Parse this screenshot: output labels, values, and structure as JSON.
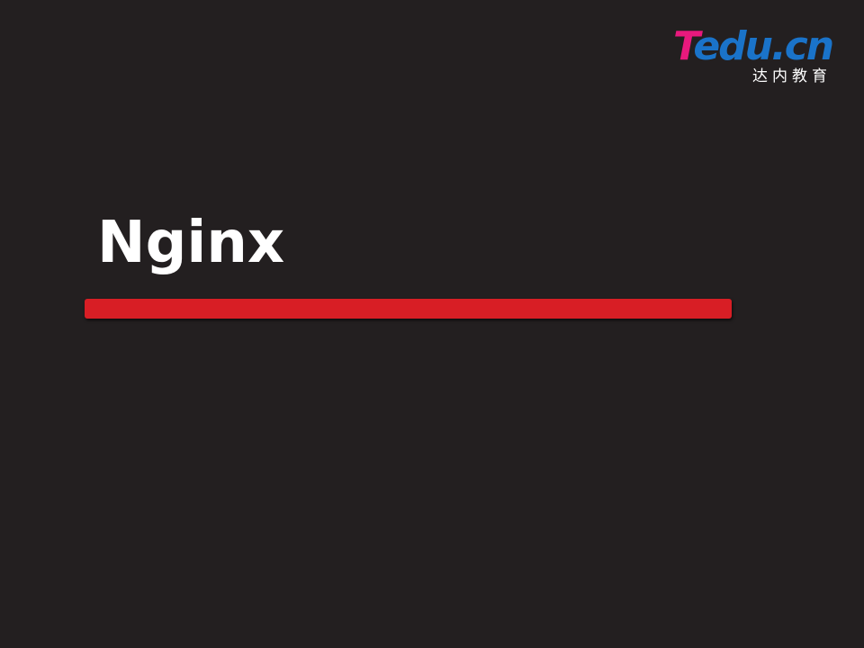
{
  "logo": {
    "brand_first": "T",
    "brand_rest": "edu.cn",
    "subtitle": "达内教育",
    "colors": {
      "pink": "#e8197d",
      "blue": "#1a73c9"
    }
  },
  "slide": {
    "title": "Nginx",
    "accent_color": "#d81e25",
    "background_color": "#231f20"
  }
}
